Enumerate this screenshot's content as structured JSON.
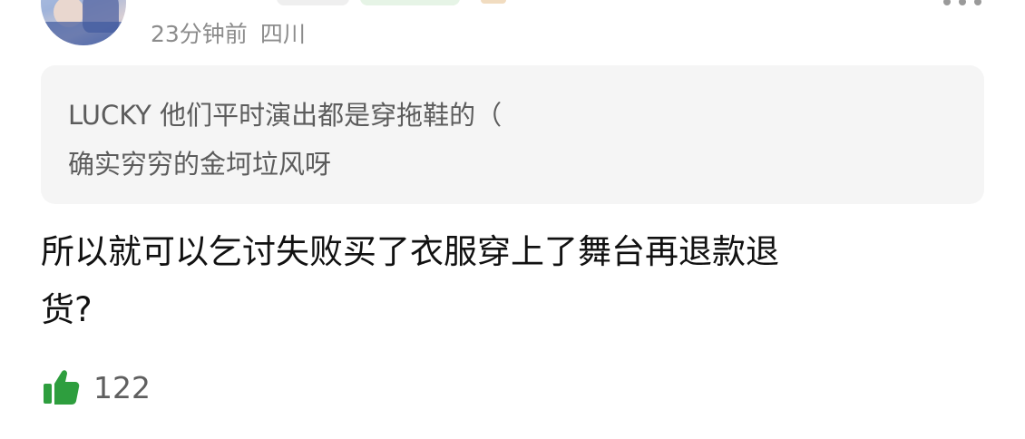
{
  "comment": {
    "meta": {
      "time": "23分钟前",
      "location": "四川"
    },
    "quote": {
      "lines": [
        "LUCKY 他们平时演出都是穿拖鞋的（",
        "确实穷穷的金坷垃风呀"
      ]
    },
    "content": {
      "lines": [
        "所以就可以乞讨失败买了衣服穿上了舞台再退款退",
        "货?"
      ]
    },
    "likes": {
      "count": "122"
    }
  },
  "icons": {
    "like": "thumbs-up-icon",
    "more": "more-dots-icon"
  },
  "colors": {
    "like_green": "#2e9e3e",
    "quote_bg": "#f5f5f5",
    "meta_text": "#8c8c8c"
  }
}
